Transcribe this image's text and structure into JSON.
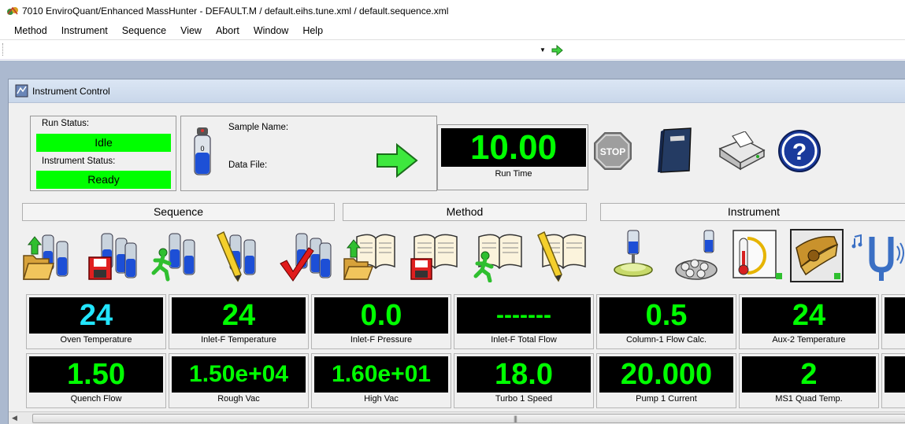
{
  "window": {
    "title": "7010 EnviroQuant/Enhanced MassHunter - DEFAULT.M / default.eihs.tune.xml / default.sequence.xml"
  },
  "menu": [
    "Method",
    "Instrument",
    "Sequence",
    "View",
    "Abort",
    "Window",
    "Help"
  ],
  "toolbar": {
    "combo_value": ""
  },
  "instrument_window": {
    "title": "Instrument Control"
  },
  "status": {
    "run_status_label": "Run Status:",
    "run_status_value": "Idle",
    "instrument_status_label": "Instrument Status:",
    "instrument_status_value": "Ready"
  },
  "sample": {
    "sample_name_label": "Sample Name:",
    "data_file_label": "Data File:",
    "vial_number": "0"
  },
  "run_time": {
    "value": "10.00",
    "label": "Run Time"
  },
  "stop_label": "STOP",
  "sections": {
    "sequence": "Sequence",
    "method": "Method",
    "instrument": "Instrument"
  },
  "monitors_row1": [
    {
      "value": "24",
      "label": "Oven Temperature",
      "color": "cyan"
    },
    {
      "value": "24",
      "label": "Inlet-F Temperature",
      "color": "green"
    },
    {
      "value": "0.0",
      "label": "Inlet-F Pressure",
      "color": "green"
    },
    {
      "value": "-------",
      "label": "Inlet-F Total Flow",
      "color": "green"
    },
    {
      "value": "0.5",
      "label": "Column-1 Flow Calc.",
      "color": "green"
    },
    {
      "value": "24",
      "label": "Aux-2 Temperature",
      "color": "green"
    }
  ],
  "monitors_row2": [
    {
      "value": "1.50",
      "label": "Quench Flow",
      "color": "green"
    },
    {
      "value": "1.50e+04",
      "label": "Rough Vac",
      "color": "green"
    },
    {
      "value": "1.60e+01",
      "label": "High Vac",
      "color": "green"
    },
    {
      "value": "18.0",
      "label": "Turbo 1 Speed",
      "color": "green"
    },
    {
      "value": "20.000",
      "label": "Pump 1 Current",
      "color": "green"
    },
    {
      "value": "2",
      "label": "MS1 Quad Temp.",
      "color": "green"
    }
  ],
  "colors": {
    "status_green": "#00ff00",
    "display_green": "#00ff00",
    "display_cyan": "#22e5ff",
    "mdi_background": "#abb9cf"
  }
}
